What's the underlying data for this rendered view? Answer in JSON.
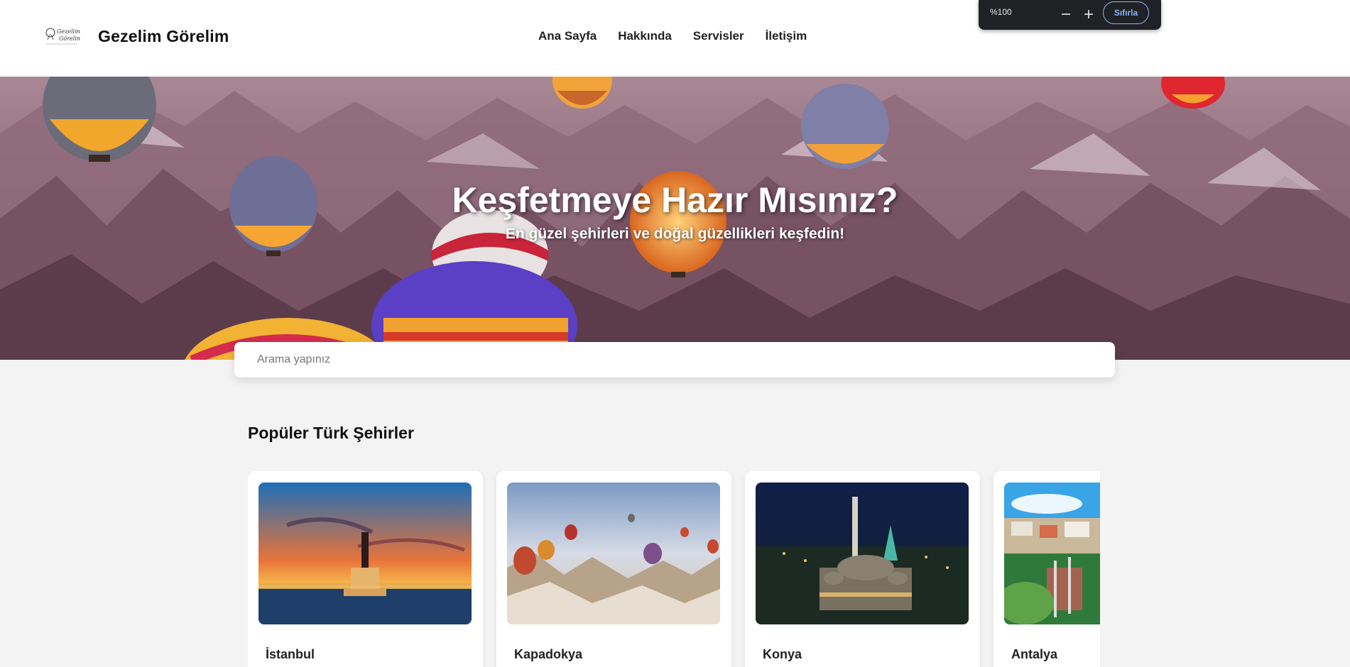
{
  "header": {
    "logo_text": "Gezelim Görelim",
    "brand": "Gezelim Görelim",
    "nav": [
      {
        "label": "Ana Sayfa"
      },
      {
        "label": "Hakkında"
      },
      {
        "label": "Servisler"
      },
      {
        "label": "İletişim"
      }
    ]
  },
  "zoom": {
    "level": "%100",
    "minus_icon": "minus-icon",
    "plus_icon": "plus-icon",
    "reset_label": "Sıfırla"
  },
  "hero": {
    "title": "Keşfetmeye Hazır Mısınız?",
    "subtitle": "En güzel şehirleri ve doğal güzellikleri keşfedin!"
  },
  "search": {
    "value": "",
    "placeholder": "Arama yapınız"
  },
  "section": {
    "title": "Popüler Türk Şehirler"
  },
  "cities": [
    {
      "name": "İstanbul"
    },
    {
      "name": "Kapadokya"
    },
    {
      "name": "Konya"
    },
    {
      "name": "Antalya"
    }
  ]
}
